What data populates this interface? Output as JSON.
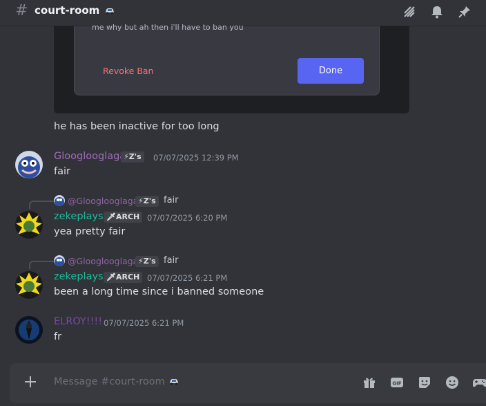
{
  "channel": {
    "name": "court-room"
  },
  "embed": {
    "cut_text": "me why but ah then i'll have to ban you",
    "revoke_label": "Revoke Ban",
    "done_label": "Done"
  },
  "messages": [
    {
      "text": "he has been inactive for too long"
    },
    {
      "username": "Glooglooglaga",
      "badge": "⚡Z's",
      "timestamp": "07/07/2025 12:39 PM",
      "text": "fair",
      "color": "#a16bb7"
    },
    {
      "reply": {
        "name": "@Glooglooglaga",
        "badge": "⚡Z's",
        "text": "fair"
      },
      "username": "zekeplays",
      "badge": "🗡ARCH",
      "timestamp": "07/07/2025 6:20 PM",
      "text": "yea pretty fair",
      "color": "#1abc9c"
    },
    {
      "reply": {
        "name": "@Glooglooglaga",
        "badge": "⚡Z's",
        "text": "fair"
      },
      "username": "zekeplays",
      "badge": "🗡ARCH",
      "timestamp": "07/07/2025 6:21 PM",
      "text": "been a long time since i banned someone",
      "color": "#1abc9c"
    },
    {
      "username": "ELROY!!!!",
      "timestamp": "07/07/2025 6:21 PM",
      "text": "fr",
      "color": "#7a45a8"
    }
  ],
  "input": {
    "placeholder": "Message #court-room"
  },
  "icons": [
    "threads-icon",
    "bell-icon",
    "pin-icon",
    "plus-icon",
    "gift-icon",
    "gif-icon",
    "sticker-icon",
    "emoji-icon",
    "apps-icon"
  ]
}
